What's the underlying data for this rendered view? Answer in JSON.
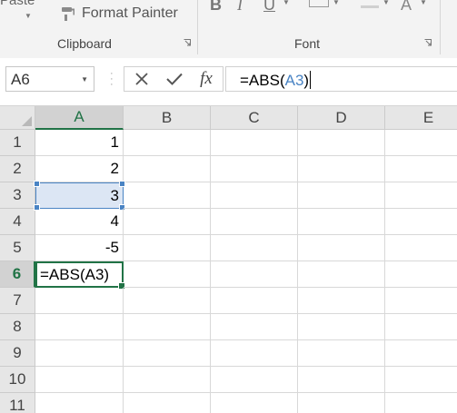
{
  "ribbon": {
    "paste_label": "Paste",
    "format_painter_label": "Format Painter",
    "clipboard_group_label": "Clipboard",
    "font_group_label": "Font",
    "bold_label": "B",
    "italic_label": "I",
    "underline_label": "U"
  },
  "formula_bar": {
    "name_box": "A6",
    "fx_label": "fx",
    "formula_prefix": "=ABS(",
    "formula_ref": "A3",
    "formula_suffix": ")"
  },
  "grid": {
    "columns": [
      "A",
      "B",
      "C",
      "D",
      "E"
    ],
    "selected_column": "A",
    "rows": [
      "1",
      "2",
      "3",
      "4",
      "5",
      "6",
      "7",
      "8",
      "9",
      "10",
      "11"
    ],
    "selected_row": "6",
    "column_a_values": [
      "1",
      "2",
      "3",
      "4",
      "-5"
    ],
    "active_cell_text": "=ABS(A3)",
    "referenced_cell": "A3"
  },
  "colors": {
    "excel_green": "#217346",
    "reference_blue": "#4a84c4",
    "reference_fill": "#dce6f4"
  },
  "icons": [
    "format-painter-icon",
    "dialog-launcher-icon",
    "cancel-icon",
    "enter-checkmark-icon",
    "insert-function-icon",
    "name-box-dropdown-icon"
  ]
}
